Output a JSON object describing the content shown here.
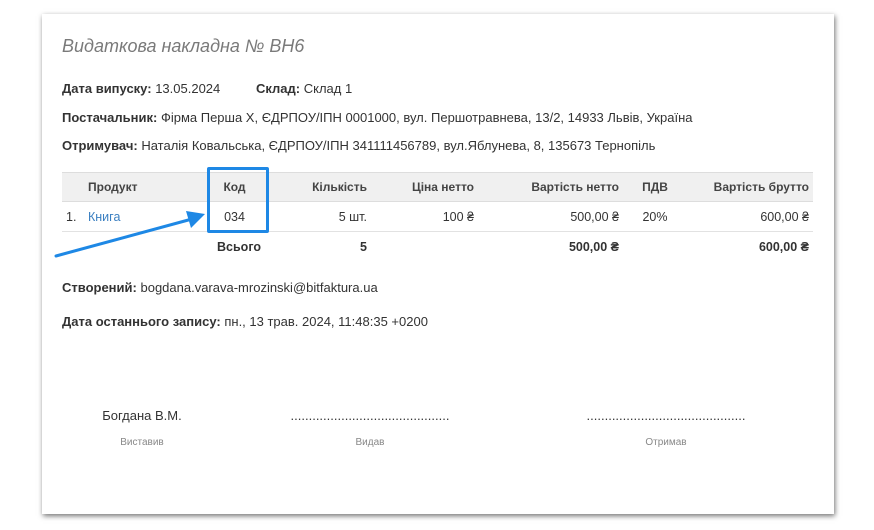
{
  "document": {
    "title": "Видаткова накладна № ВН6",
    "issue_date_label": "Дата випуску:",
    "issue_date": "13.05.2024",
    "warehouse_label": "Склад:",
    "warehouse": "Склад 1",
    "supplier_label": "Постачальник:",
    "supplier": "Фірма Перша Х, ЄДРПОУ/ІПН 0001000, вул. Першотравнева, 13/2, 14933 Львів, Україна",
    "recipient_label": "Отримувач:",
    "recipient": "Наталія Ковальська, ЄДРПОУ/ІПН 341111456789, вул.Яблунева, 8, 135673 Тернопіль",
    "created_label": "Створений:",
    "created": "bogdana.varava-mrozinski@bitfaktura.ua",
    "last_saved_label": "Дата останнього запису:",
    "last_saved": "пн., 13 трав. 2024, 11:48:35 +0200"
  },
  "table": {
    "headers": {
      "product": "Продукт",
      "code": "Код",
      "qty": "Кількість",
      "price_net": "Ціна нетто",
      "value_net": "Вартість нетто",
      "vat": "ПДВ",
      "value_gross": "Вартість брутто"
    },
    "rows": [
      {
        "num": "1.",
        "product": "Книга",
        "code": "034",
        "qty": "5 шт.",
        "price_net": "100 ₴",
        "value_net": "500,00 ₴",
        "vat": "20%",
        "value_gross": "600,00 ₴"
      }
    ],
    "total": {
      "label": "Всього",
      "qty": "5",
      "value_net": "500,00 ₴",
      "value_gross": "600,00 ₴"
    }
  },
  "signatures": {
    "issued_by": "Богдана В.М.",
    "issued_by_caption": "Виставив",
    "dispatched": "............................................",
    "dispatched_caption": "Видав",
    "received": "............................................",
    "received_caption": "Отримав"
  },
  "colors": {
    "highlight": "#1e88e5",
    "link": "#3a7fc1"
  }
}
